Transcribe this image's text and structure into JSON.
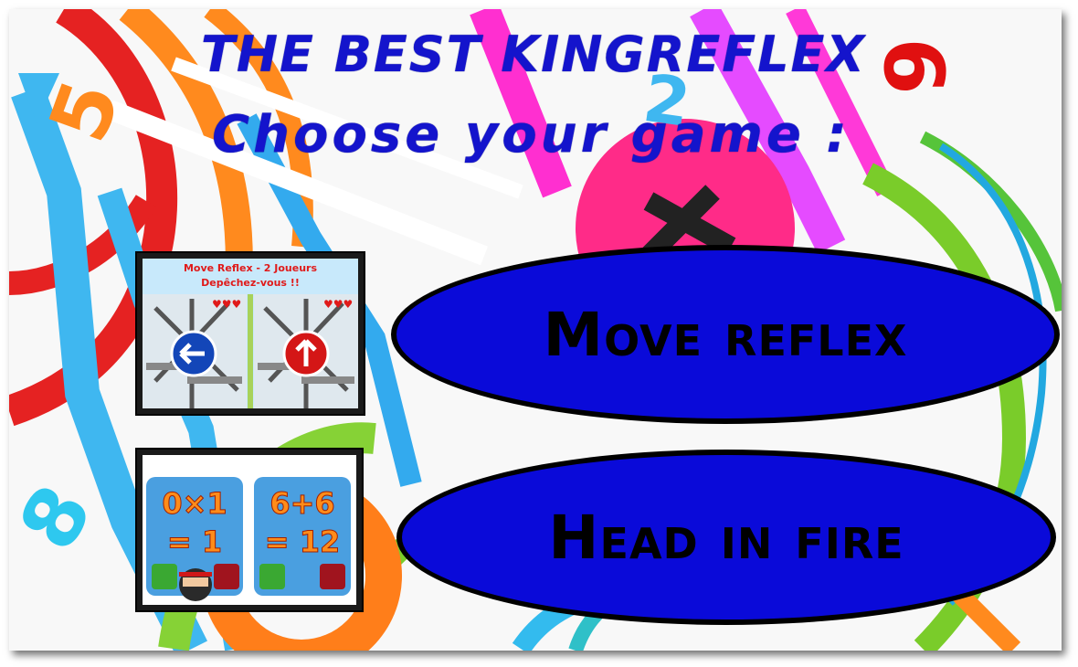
{
  "header": {
    "title": "THE BEST KINGREFLEX",
    "subtitle": "Choose your game :"
  },
  "games": [
    {
      "label": "Move reflex",
      "thumbnail": {
        "title_line1": "Move Reflex - 2 Joueurs",
        "title_line2": "Depêchez-vous !!",
        "left_icon": "arrow-left-icon",
        "right_icon": "arrow-up-icon",
        "hearts": "♥♥♥"
      }
    },
    {
      "label": "Head in fire",
      "thumbnail": {
        "left_equation": "0×1",
        "left_result": "= 1",
        "right_equation": "6+6",
        "right_result": "= 12"
      }
    }
  ],
  "colors": {
    "title": "#1414cc",
    "button_fill": "#0a0ad9",
    "button_border": "#000000"
  },
  "background_digits": [
    "5",
    "2",
    "6",
    "8"
  ]
}
